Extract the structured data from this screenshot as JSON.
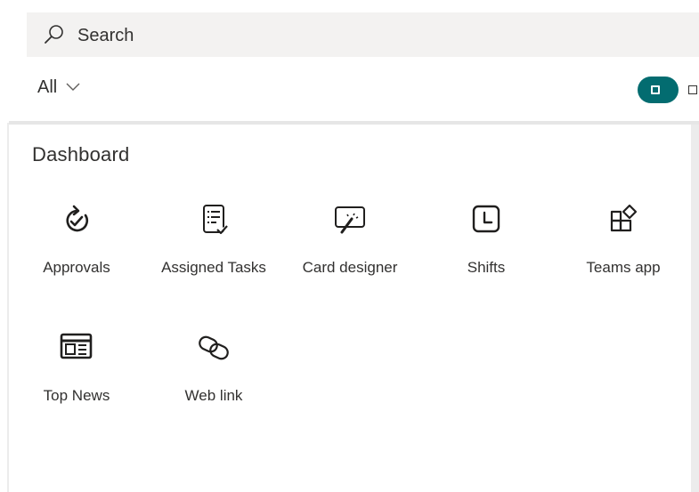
{
  "search": {
    "placeholder": "Search",
    "icon": "search-icon"
  },
  "filter": {
    "label": "All",
    "icon": "chevron-down-icon"
  },
  "toggle": {
    "state": "on",
    "accent": "#036c70"
  },
  "panel": {
    "title": "Dashboard",
    "tiles": [
      {
        "label": "Approvals",
        "icon": "approvals-icon"
      },
      {
        "label": "Assigned Tasks",
        "icon": "assigned-tasks-icon"
      },
      {
        "label": "Card designer",
        "icon": "card-designer-icon"
      },
      {
        "label": "Shifts",
        "icon": "shifts-icon"
      },
      {
        "label": "Teams app",
        "icon": "teams-app-icon"
      },
      {
        "label": "Top News",
        "icon": "top-news-icon"
      },
      {
        "label": "Web link",
        "icon": "web-link-icon"
      }
    ]
  }
}
